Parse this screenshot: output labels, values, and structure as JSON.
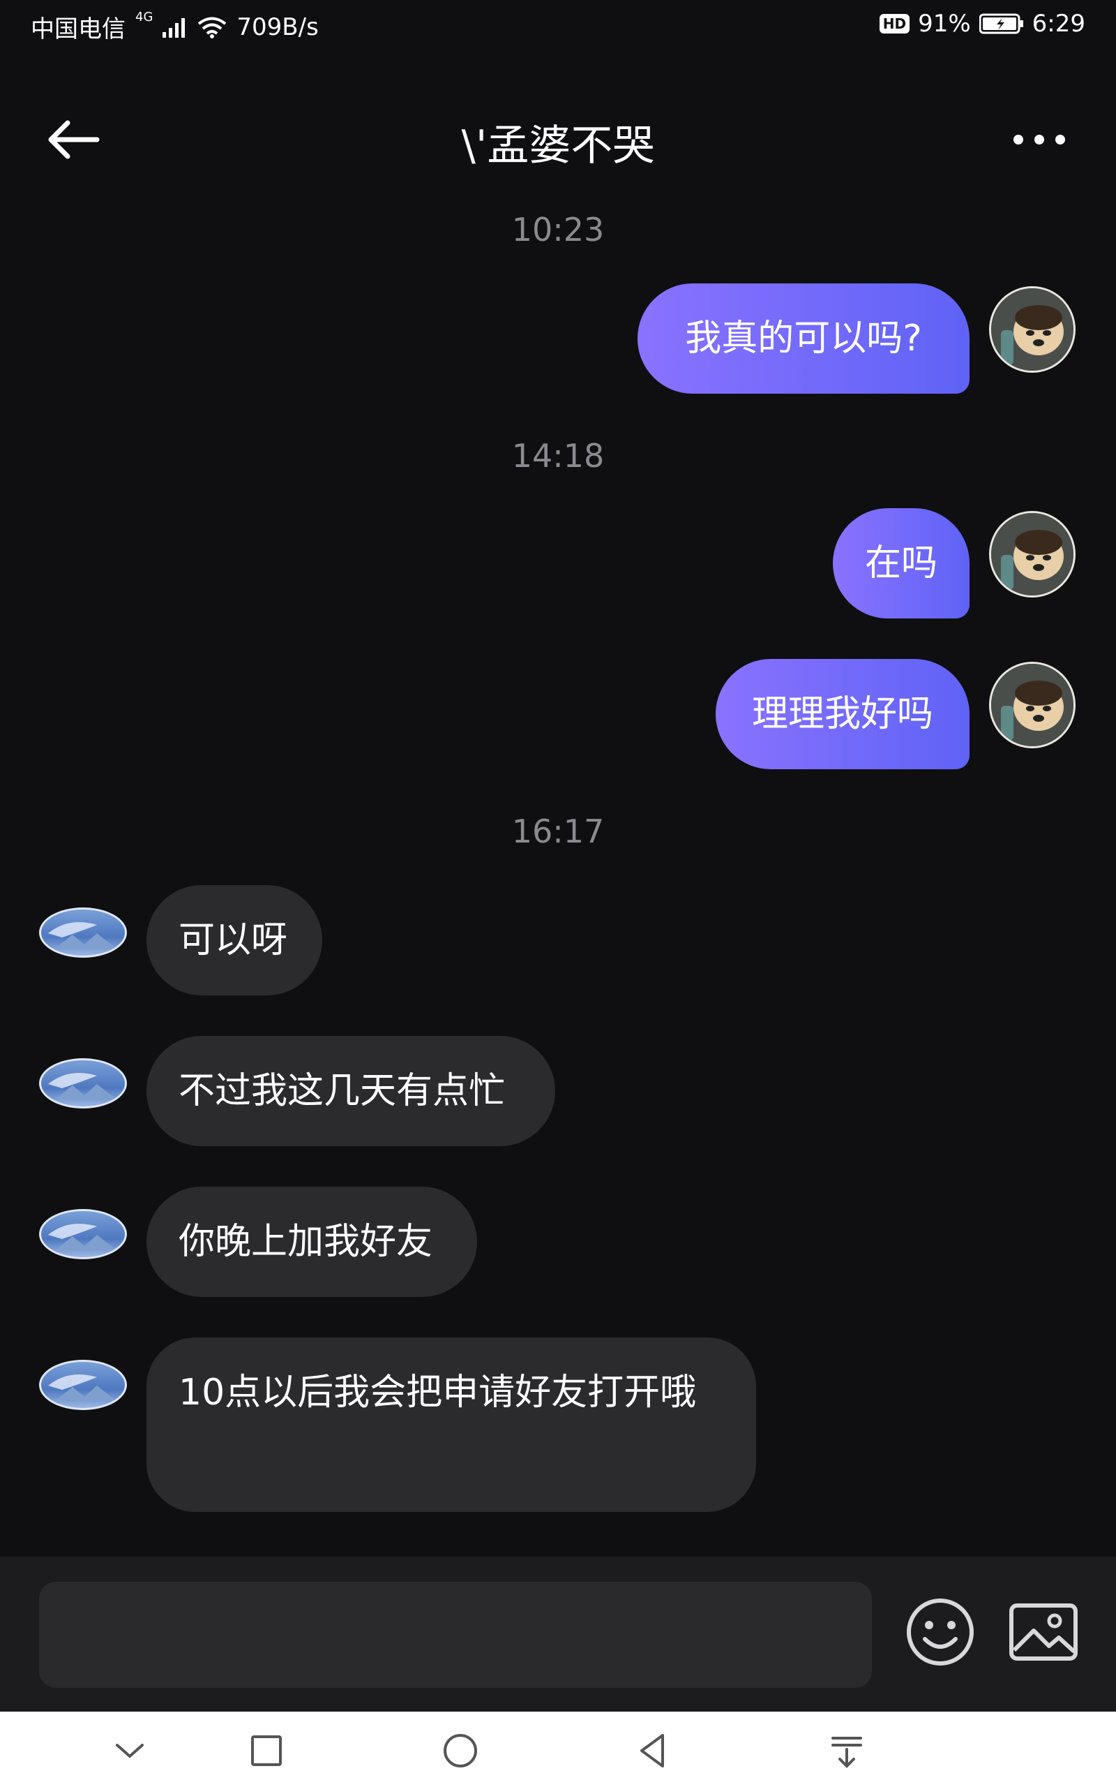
{
  "status_bar": {
    "carrier": "中国电信",
    "network": "4G",
    "speed": "709B/s",
    "hd": "HD",
    "battery": "91%",
    "time": "6:29"
  },
  "header": {
    "title": "\\'孟婆不哭"
  },
  "messages": {
    "t1": "10:23",
    "m1": "我真的可以吗?",
    "t2": "14:18",
    "m2": "在吗",
    "m3": "理理我好吗",
    "t3": "16:17",
    "m4": "可以呀",
    "m5": "不过我这几天有点忙",
    "m6": "你晚上加我好友",
    "m7": "10点以后我会把申请好友打开哦"
  },
  "input": {
    "value": "",
    "placeholder": ""
  },
  "icons": {
    "back": "back-arrow-icon",
    "more": "more-dots-icon",
    "emoji": "emoji-icon",
    "image": "image-icon"
  },
  "colors": {
    "background": "#0f0f11",
    "outgoing_bubble_start": "#8a72ff",
    "outgoing_bubble_end": "#5f63f6",
    "incoming_bubble": "#2b2b2e",
    "timestamp": "#8a8a90"
  }
}
